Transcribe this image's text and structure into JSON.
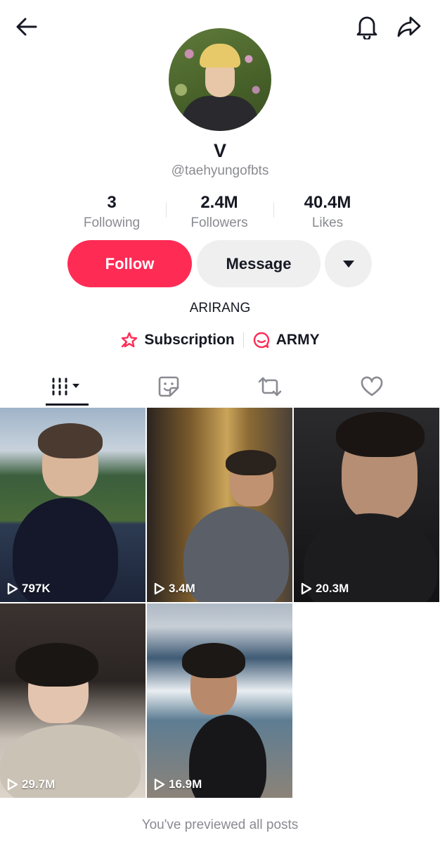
{
  "profile": {
    "name": "V",
    "handle": "@taehyungofbts",
    "bio": "ARIRANG"
  },
  "stats": [
    {
      "value": "3",
      "label": "Following"
    },
    {
      "value": "2.4M",
      "label": "Followers"
    },
    {
      "value": "40.4M",
      "label": "Likes"
    }
  ],
  "actions": {
    "follow_label": "Follow",
    "message_label": "Message"
  },
  "links": [
    {
      "label": "Subscription",
      "icon": "star-badge-icon"
    },
    {
      "label": "ARMY",
      "icon": "chat-bubble-icon"
    }
  ],
  "tabs": [
    {
      "icon": "videos-grid-icon",
      "active": true
    },
    {
      "icon": "sticker-icon"
    },
    {
      "icon": "repost-icon"
    },
    {
      "icon": "heart-icon"
    }
  ],
  "videos": [
    {
      "views": "797K"
    },
    {
      "views": "3.4M"
    },
    {
      "views": "20.3M"
    },
    {
      "views": "29.7M"
    },
    {
      "views": "16.9M"
    }
  ],
  "footer": "You've previewed all posts",
  "colors": {
    "accent": "#fe2c55",
    "secondary_button": "#efeff0",
    "muted_text": "#8a8b91"
  }
}
